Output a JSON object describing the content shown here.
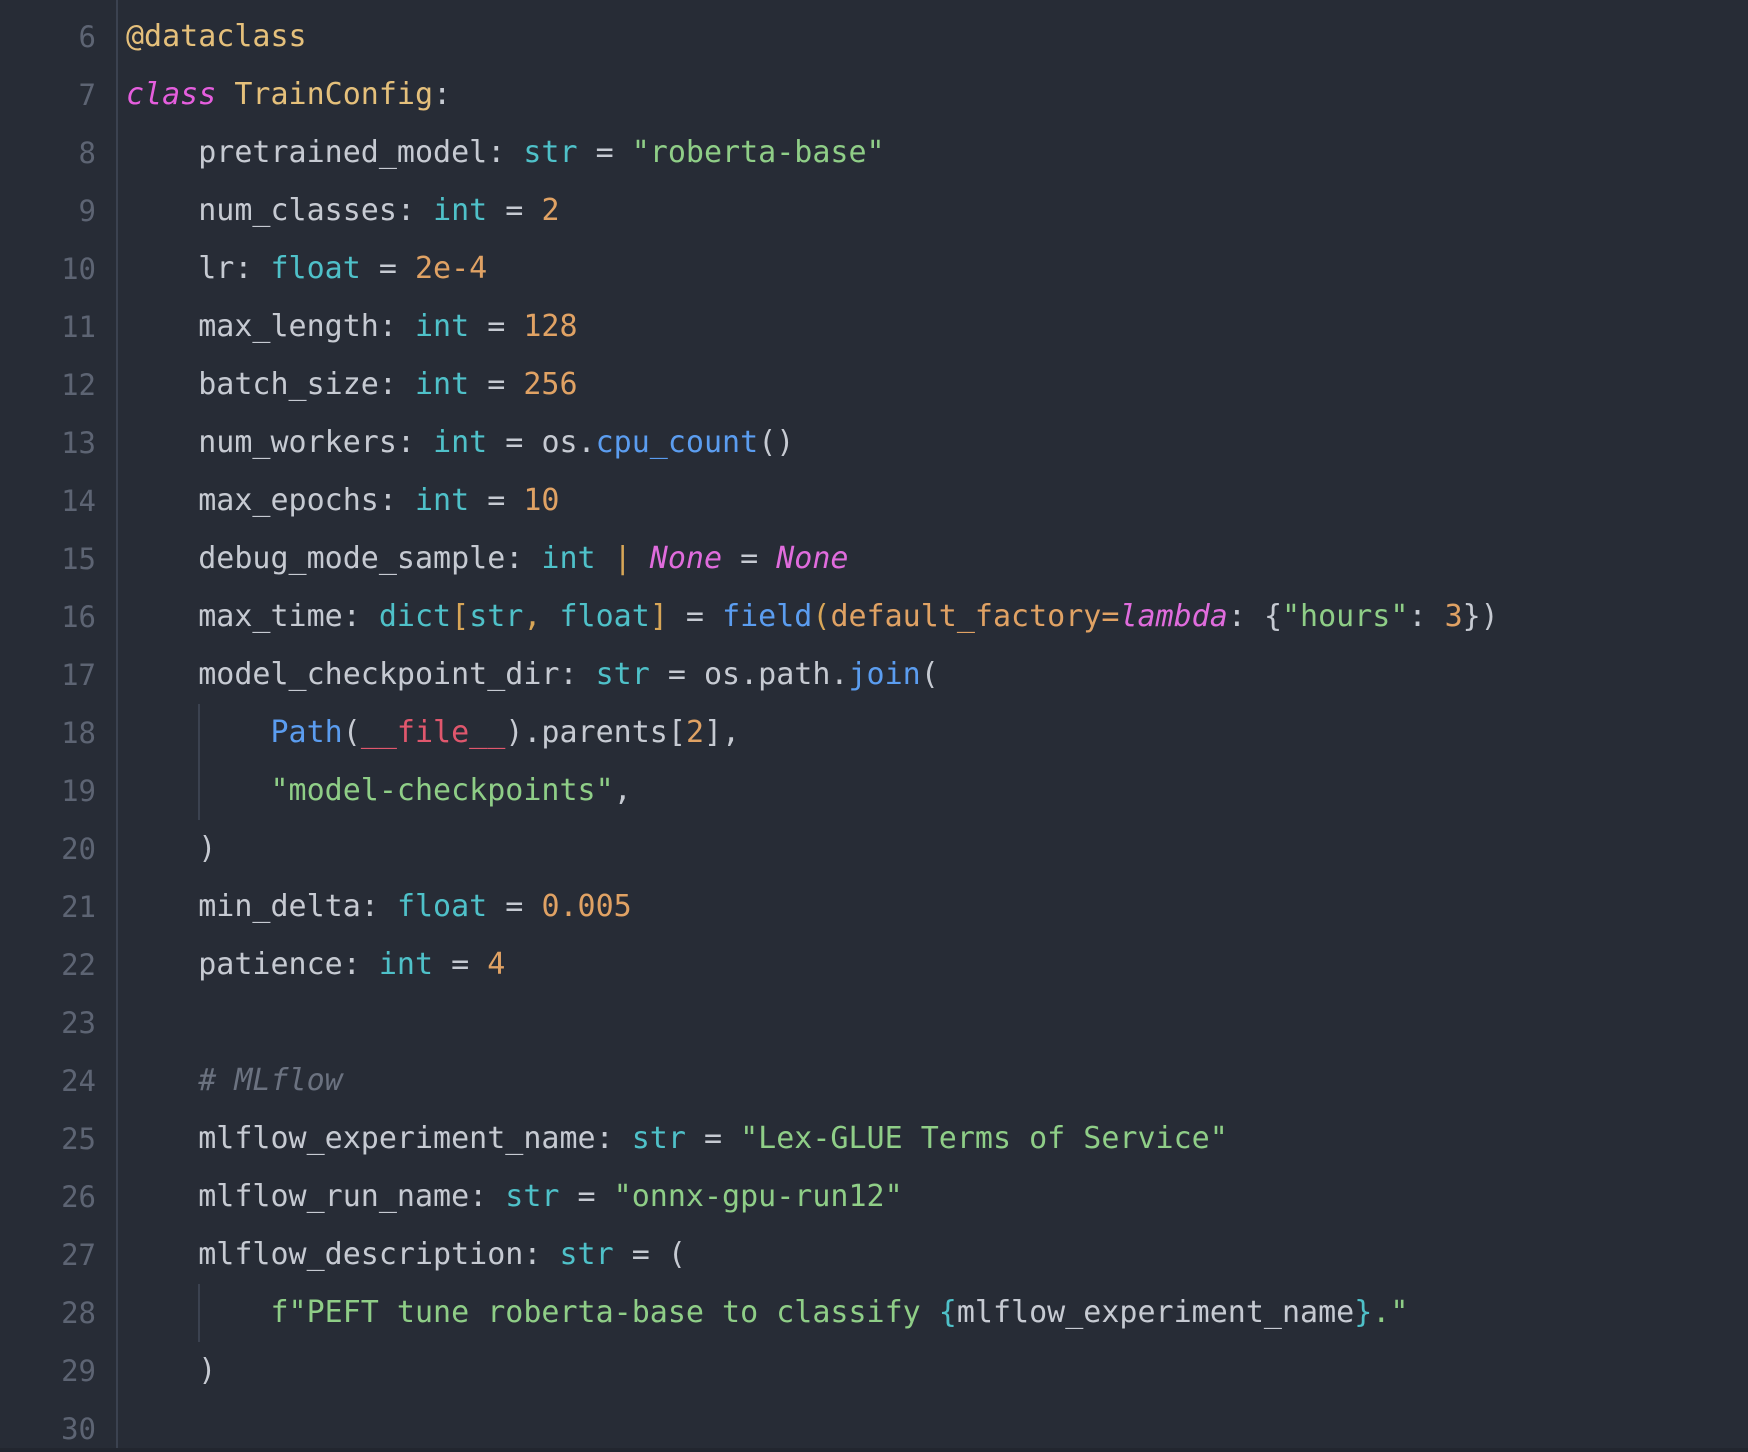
{
  "editor": {
    "language": "python",
    "theme": "dark",
    "background_color": "#272c36",
    "gutter_color": "#5d6473",
    "colors": {
      "plain": "#c6cad2",
      "decorator": "#e5c07b",
      "keyword": "#e55ede",
      "class_name": "#e5c07b",
      "type": "#4fc1c9",
      "string": "#8fce87",
      "number": "#e0a264",
      "function": "#5b9df0",
      "bracket": "#d8a657",
      "comment": "#6b7280",
      "magic": "#e0576d",
      "fstring_brace": "#4fc1c9"
    },
    "first_line_number": 6,
    "last_line_number": 30,
    "line_numbers": [
      6,
      7,
      8,
      9,
      10,
      11,
      12,
      13,
      14,
      15,
      16,
      17,
      18,
      19,
      20,
      21,
      22,
      23,
      24,
      25,
      26,
      27,
      28,
      29,
      30
    ],
    "lines": [
      {
        "n": 6,
        "text": "@dataclass",
        "tokens": [
          {
            "t": "@dataclass",
            "c": "t-decor"
          }
        ]
      },
      {
        "n": 7,
        "text": "class TrainConfig:",
        "tokens": [
          {
            "t": "class",
            "c": "t-kw"
          },
          {
            "t": " ",
            "c": "t-plain"
          },
          {
            "t": "TrainConfig",
            "c": "t-class"
          },
          {
            "t": ":",
            "c": "t-plain"
          }
        ]
      },
      {
        "n": 8,
        "text": "    pretrained_model: str = \"roberta-base\"",
        "tokens": [
          {
            "t": "    pretrained_model",
            "c": "t-plain"
          },
          {
            "t": ": ",
            "c": "t-plain"
          },
          {
            "t": "str",
            "c": "t-type"
          },
          {
            "t": " = ",
            "c": "t-op"
          },
          {
            "t": "\"roberta-base\"",
            "c": "t-str"
          }
        ]
      },
      {
        "n": 9,
        "text": "    num_classes: int = 2",
        "tokens": [
          {
            "t": "    num_classes",
            "c": "t-plain"
          },
          {
            "t": ": ",
            "c": "t-plain"
          },
          {
            "t": "int",
            "c": "t-type"
          },
          {
            "t": " = ",
            "c": "t-op"
          },
          {
            "t": "2",
            "c": "t-num"
          }
        ]
      },
      {
        "n": 10,
        "text": "    lr: float = 2e-4",
        "tokens": [
          {
            "t": "    lr",
            "c": "t-plain"
          },
          {
            "t": ": ",
            "c": "t-plain"
          },
          {
            "t": "float",
            "c": "t-type"
          },
          {
            "t": " = ",
            "c": "t-op"
          },
          {
            "t": "2e-4",
            "c": "t-num"
          }
        ]
      },
      {
        "n": 11,
        "text": "    max_length: int = 128",
        "tokens": [
          {
            "t": "    max_length",
            "c": "t-plain"
          },
          {
            "t": ": ",
            "c": "t-plain"
          },
          {
            "t": "int",
            "c": "t-type"
          },
          {
            "t": " = ",
            "c": "t-op"
          },
          {
            "t": "128",
            "c": "t-num"
          }
        ]
      },
      {
        "n": 12,
        "text": "    batch_size: int = 256",
        "tokens": [
          {
            "t": "    batch_size",
            "c": "t-plain"
          },
          {
            "t": ": ",
            "c": "t-plain"
          },
          {
            "t": "int",
            "c": "t-type"
          },
          {
            "t": " = ",
            "c": "t-op"
          },
          {
            "t": "256",
            "c": "t-num"
          }
        ]
      },
      {
        "n": 13,
        "text": "    num_workers: int = os.cpu_count()",
        "tokens": [
          {
            "t": "    num_workers",
            "c": "t-plain"
          },
          {
            "t": ": ",
            "c": "t-plain"
          },
          {
            "t": "int",
            "c": "t-type"
          },
          {
            "t": " = ",
            "c": "t-op"
          },
          {
            "t": "os.",
            "c": "t-plain"
          },
          {
            "t": "cpu_count",
            "c": "t-func"
          },
          {
            "t": "()",
            "c": "t-plain"
          }
        ]
      },
      {
        "n": 14,
        "text": "    max_epochs: int = 10",
        "tokens": [
          {
            "t": "    max_epochs",
            "c": "t-plain"
          },
          {
            "t": ": ",
            "c": "t-plain"
          },
          {
            "t": "int",
            "c": "t-type"
          },
          {
            "t": " = ",
            "c": "t-op"
          },
          {
            "t": "10",
            "c": "t-num"
          }
        ]
      },
      {
        "n": 15,
        "text": "    debug_mode_sample: int | None = None",
        "tokens": [
          {
            "t": "    debug_mode_sample",
            "c": "t-plain"
          },
          {
            "t": ": ",
            "c": "t-plain"
          },
          {
            "t": "int",
            "c": "t-type"
          },
          {
            "t": " ",
            "c": "t-plain"
          },
          {
            "t": "|",
            "c": "t-bracket"
          },
          {
            "t": " ",
            "c": "t-plain"
          },
          {
            "t": "None",
            "c": "t-kw2"
          },
          {
            "t": " = ",
            "c": "t-op"
          },
          {
            "t": "None",
            "c": "t-kw2"
          }
        ]
      },
      {
        "n": 16,
        "text": "    max_time: dict[str, float] = field(default_factory=lambda: {\"hours\": 3})",
        "tokens": [
          {
            "t": "    max_time",
            "c": "t-plain"
          },
          {
            "t": ": ",
            "c": "t-plain"
          },
          {
            "t": "dict",
            "c": "t-type"
          },
          {
            "t": "[",
            "c": "t-bracket"
          },
          {
            "t": "str",
            "c": "t-type"
          },
          {
            "t": ",",
            "c": "t-bracket"
          },
          {
            "t": " ",
            "c": "t-plain"
          },
          {
            "t": "float",
            "c": "t-type"
          },
          {
            "t": "]",
            "c": "t-bracket"
          },
          {
            "t": " = ",
            "c": "t-op"
          },
          {
            "t": "field",
            "c": "t-func"
          },
          {
            "t": "(",
            "c": "t-bracket"
          },
          {
            "t": "default_factory",
            "c": "t-param"
          },
          {
            "t": "=",
            "c": "t-param"
          },
          {
            "t": "lambda",
            "c": "t-kw2"
          },
          {
            "t": ": ",
            "c": "t-plain"
          },
          {
            "t": "{",
            "c": "t-plain"
          },
          {
            "t": "\"hours\"",
            "c": "t-str"
          },
          {
            "t": ": ",
            "c": "t-plain"
          },
          {
            "t": "3",
            "c": "t-num"
          },
          {
            "t": "})",
            "c": "t-plain"
          }
        ]
      },
      {
        "n": 17,
        "text": "    model_checkpoint_dir: str = os.path.join(",
        "tokens": [
          {
            "t": "    model_checkpoint_dir",
            "c": "t-plain"
          },
          {
            "t": ": ",
            "c": "t-plain"
          },
          {
            "t": "str",
            "c": "t-type"
          },
          {
            "t": " = ",
            "c": "t-op"
          },
          {
            "t": "os.path.",
            "c": "t-plain"
          },
          {
            "t": "join",
            "c": "t-func"
          },
          {
            "t": "(",
            "c": "t-plain"
          }
        ]
      },
      {
        "n": 18,
        "text": "        Path(__file__).parents[2],",
        "tokens": [
          {
            "t": "        ",
            "c": "t-plain"
          },
          {
            "t": "Path",
            "c": "t-func"
          },
          {
            "t": "(",
            "c": "t-plain"
          },
          {
            "t": "__file__",
            "c": "t-magic"
          },
          {
            "t": ").parents",
            "c": "t-plain"
          },
          {
            "t": "[",
            "c": "t-plain"
          },
          {
            "t": "2",
            "c": "t-num"
          },
          {
            "t": "],",
            "c": "t-plain"
          }
        ]
      },
      {
        "n": 19,
        "text": "        \"model-checkpoints\",",
        "tokens": [
          {
            "t": "        ",
            "c": "t-plain"
          },
          {
            "t": "\"model-checkpoints\"",
            "c": "t-str"
          },
          {
            "t": ",",
            "c": "t-plain"
          }
        ]
      },
      {
        "n": 20,
        "text": "    )",
        "tokens": [
          {
            "t": "    )",
            "c": "t-plain"
          }
        ]
      },
      {
        "n": 21,
        "text": "    min_delta: float = 0.005",
        "tokens": [
          {
            "t": "    min_delta",
            "c": "t-plain"
          },
          {
            "t": ": ",
            "c": "t-plain"
          },
          {
            "t": "float",
            "c": "t-type"
          },
          {
            "t": " = ",
            "c": "t-op"
          },
          {
            "t": "0.005",
            "c": "t-num"
          }
        ]
      },
      {
        "n": 22,
        "text": "    patience: int = 4",
        "tokens": [
          {
            "t": "    patience",
            "c": "t-plain"
          },
          {
            "t": ": ",
            "c": "t-plain"
          },
          {
            "t": "int",
            "c": "t-type"
          },
          {
            "t": " = ",
            "c": "t-op"
          },
          {
            "t": "4",
            "c": "t-num"
          }
        ]
      },
      {
        "n": 23,
        "text": "",
        "tokens": []
      },
      {
        "n": 24,
        "text": "    # MLflow",
        "tokens": [
          {
            "t": "    ",
            "c": "t-plain"
          },
          {
            "t": "# MLflow",
            "c": "t-comment"
          }
        ]
      },
      {
        "n": 25,
        "text": "    mlflow_experiment_name: str = \"Lex-GLUE Terms of Service\"",
        "tokens": [
          {
            "t": "    mlflow_experiment_name",
            "c": "t-plain"
          },
          {
            "t": ": ",
            "c": "t-plain"
          },
          {
            "t": "str",
            "c": "t-type"
          },
          {
            "t": " = ",
            "c": "t-op"
          },
          {
            "t": "\"Lex-GLUE Terms of Service\"",
            "c": "t-str"
          }
        ]
      },
      {
        "n": 26,
        "text": "    mlflow_run_name: str = \"onnx-gpu-run12\"",
        "tokens": [
          {
            "t": "    mlflow_run_name",
            "c": "t-plain"
          },
          {
            "t": ": ",
            "c": "t-plain"
          },
          {
            "t": "str",
            "c": "t-type"
          },
          {
            "t": " = ",
            "c": "t-op"
          },
          {
            "t": "\"onnx-gpu-run12\"",
            "c": "t-str"
          }
        ]
      },
      {
        "n": 27,
        "text": "    mlflow_description: str = (",
        "tokens": [
          {
            "t": "    mlflow_description",
            "c": "t-plain"
          },
          {
            "t": ": ",
            "c": "t-plain"
          },
          {
            "t": "str",
            "c": "t-type"
          },
          {
            "t": " = ",
            "c": "t-op"
          },
          {
            "t": "(",
            "c": "t-plain"
          }
        ]
      },
      {
        "n": 28,
        "text": "        f\"PEFT tune roberta-base to classify {mlflow_experiment_name}.\"",
        "tokens": [
          {
            "t": "        ",
            "c": "t-plain"
          },
          {
            "t": "f\"PEFT tune roberta-base to classify ",
            "c": "t-str"
          },
          {
            "t": "{",
            "c": "t-fbrace"
          },
          {
            "t": "mlflow_experiment_name",
            "c": "t-plain"
          },
          {
            "t": "}",
            "c": "t-fbrace"
          },
          {
            "t": ".\"",
            "c": "t-str"
          }
        ]
      },
      {
        "n": 29,
        "text": "    )",
        "tokens": [
          {
            "t": "    )",
            "c": "t-plain"
          }
        ]
      },
      {
        "n": 30,
        "text": "",
        "tokens": []
      }
    ],
    "indent_guides": [
      {
        "from_line": 18,
        "to_line": 19,
        "indent_col": 4
      },
      {
        "from_line": 28,
        "to_line": 28,
        "indent_col": 4
      }
    ]
  }
}
